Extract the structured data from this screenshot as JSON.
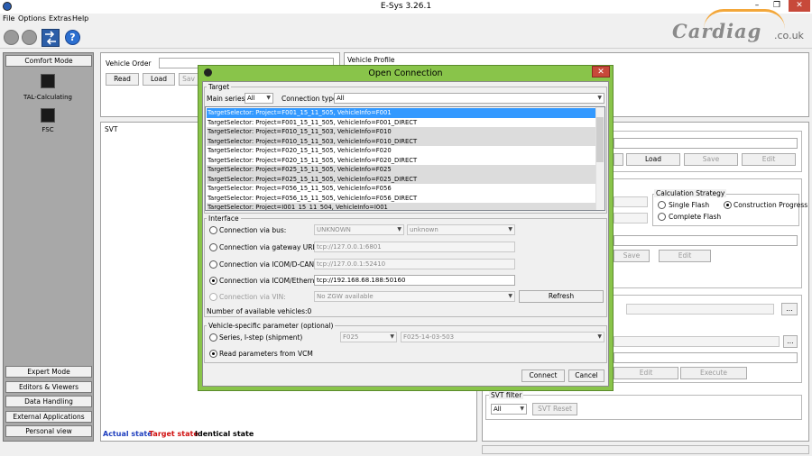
{
  "window": {
    "title": "E-Sys 3.26.1",
    "minimize": "–",
    "maximize": "❐",
    "close": "✕"
  },
  "menu": [
    "File",
    "Options",
    "Extras",
    "Help"
  ],
  "logo": {
    "text": "Cardiag",
    "domain": ".co.uk"
  },
  "sidebar": {
    "header": "Comfort Mode",
    "items": [
      {
        "label": "TAL-Calculating"
      },
      {
        "label": "FSC"
      }
    ],
    "bottom_buttons": [
      "Expert Mode",
      "Editors & Viewers",
      "Data Handling",
      "External Applications",
      "Personal view"
    ]
  },
  "vehicle_order": {
    "label": "Vehicle Order",
    "read": "Read",
    "load": "Load",
    "save": "Sav"
  },
  "vehicle_profile": {
    "label": "Vehicle Profile"
  },
  "svt": {
    "label": "SVT",
    "legend_actual": "Actual state",
    "legend_target": "Target state",
    "legend_identical": "Identical state",
    "colors": {
      "actual": "#1f3fbf",
      "target": "#d01010",
      "identical": "#000000"
    }
  },
  "right_panel": {
    "load": "Load",
    "save": "Save",
    "edit": "Edit",
    "calc_strategy": "Calculation Strategy",
    "single_flash": "Single Flash",
    "construction_progress": "Construction Progress",
    "complete_flash": "Complete Flash",
    "save2": "Save",
    "edit2": "Edit",
    "more": "...",
    "edit3": "Edit",
    "execute": "Execute",
    "svt_filter": "SVT filter",
    "filter_value": "All",
    "svt_reset": "SVT Reset"
  },
  "dialog": {
    "title": "Open Connection",
    "close": "✕",
    "target_group": "Target",
    "main_series_label": "Main series:",
    "main_series_value": "All",
    "connection_type_label": "Connection type:",
    "connection_type_value": "All",
    "targets": [
      "TargetSelector: Project=F001_15_11_505, VehicleInfo=F001",
      "TargetSelector: Project=F001_15_11_505, VehicleInfo=F001_DIRECT",
      "TargetSelector: Project=F010_15_11_503, VehicleInfo=F010",
      "TargetSelector: Project=F010_15_11_503, VehicleInfo=F010_DIRECT",
      "TargetSelector: Project=F020_15_11_505, VehicleInfo=F020",
      "TargetSelector: Project=F020_15_11_505, VehicleInfo=F020_DIRECT",
      "TargetSelector: Project=F025_15_11_505, VehicleInfo=F025",
      "TargetSelector: Project=F025_15_11_505, VehicleInfo=F025_DIRECT",
      "TargetSelector: Project=F056_15_11_505, VehicleInfo=F056",
      "TargetSelector: Project=F056_15_11_505, VehicleInfo=F056_DIRECT",
      "TargetSelector: Project=I001_15_11_504, VehicleInfo=I001"
    ],
    "interface_group": "Interface",
    "via_bus": "Connection via bus:",
    "bus_value": "UNKNOWN",
    "bus_value2": "unknown",
    "via_gateway": "Connection via gateway URL:",
    "gateway_value": "tcp://127.0.0.1:6801",
    "via_icom_dcan": "Connection via ICOM/D-CAN:",
    "icom_dcan_value": "tcp://127.0.0.1:52410",
    "via_icom_eth": "Connection via ICOM/Ethernet:",
    "icom_eth_value": "tcp://192.168.68.188:50160",
    "via_vin": "Connection via VIN:",
    "vin_value": "No ZGW available",
    "refresh": "Refresh",
    "num_vehicles": "Number of available vehicles:0",
    "vsp_group": "Vehicle-specific parameter (optional)",
    "series_istep": "Series, I-step (shipment)",
    "series_value": "F025",
    "istep_value": "F025-14-03-503",
    "read_vcm": "Read parameters from VCM",
    "connect": "Connect",
    "cancel": "Cancel"
  }
}
